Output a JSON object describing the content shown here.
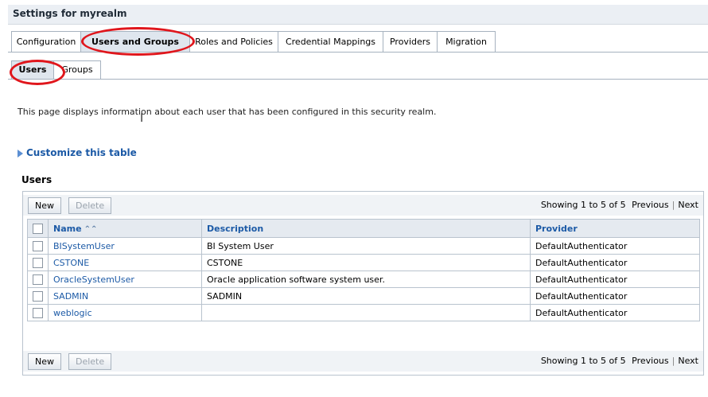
{
  "header": {
    "title": "Settings for myrealm"
  },
  "tabs": [
    {
      "label": "Configuration"
    },
    {
      "label": "Users and Groups",
      "active": true
    },
    {
      "label": "Roles and Policies"
    },
    {
      "label": "Credential Mappings"
    },
    {
      "label": "Providers"
    },
    {
      "label": "Migration"
    }
  ],
  "subtabs": [
    {
      "label": "Users",
      "active": true
    },
    {
      "label": "Groups"
    }
  ],
  "description": "This page displays information about each user that has been configured in this security realm.",
  "customize_label": "Customize this table",
  "section_title": "Users",
  "toolbar": {
    "new_label": "New",
    "delete_label": "Delete",
    "showing": "Showing 1 to 5 of 5",
    "previous": "Previous",
    "next": "Next"
  },
  "table": {
    "columns": [
      "Name",
      "Description",
      "Provider"
    ],
    "rows": [
      {
        "name": "BISystemUser",
        "description": "BI System User",
        "provider": "DefaultAuthenticator"
      },
      {
        "name": "CSTONE",
        "description": "CSTONE",
        "provider": "DefaultAuthenticator"
      },
      {
        "name": "OracleSystemUser",
        "description": "Oracle application software system user.",
        "provider": "DefaultAuthenticator"
      },
      {
        "name": "SADMIN",
        "description": "SADMIN",
        "provider": "DefaultAuthenticator"
      },
      {
        "name": "weblogic",
        "description": "",
        "provider": "DefaultAuthenticator"
      }
    ]
  },
  "colors": {
    "link": "#1c5aa6",
    "highlight_oval": "#e0161c"
  }
}
